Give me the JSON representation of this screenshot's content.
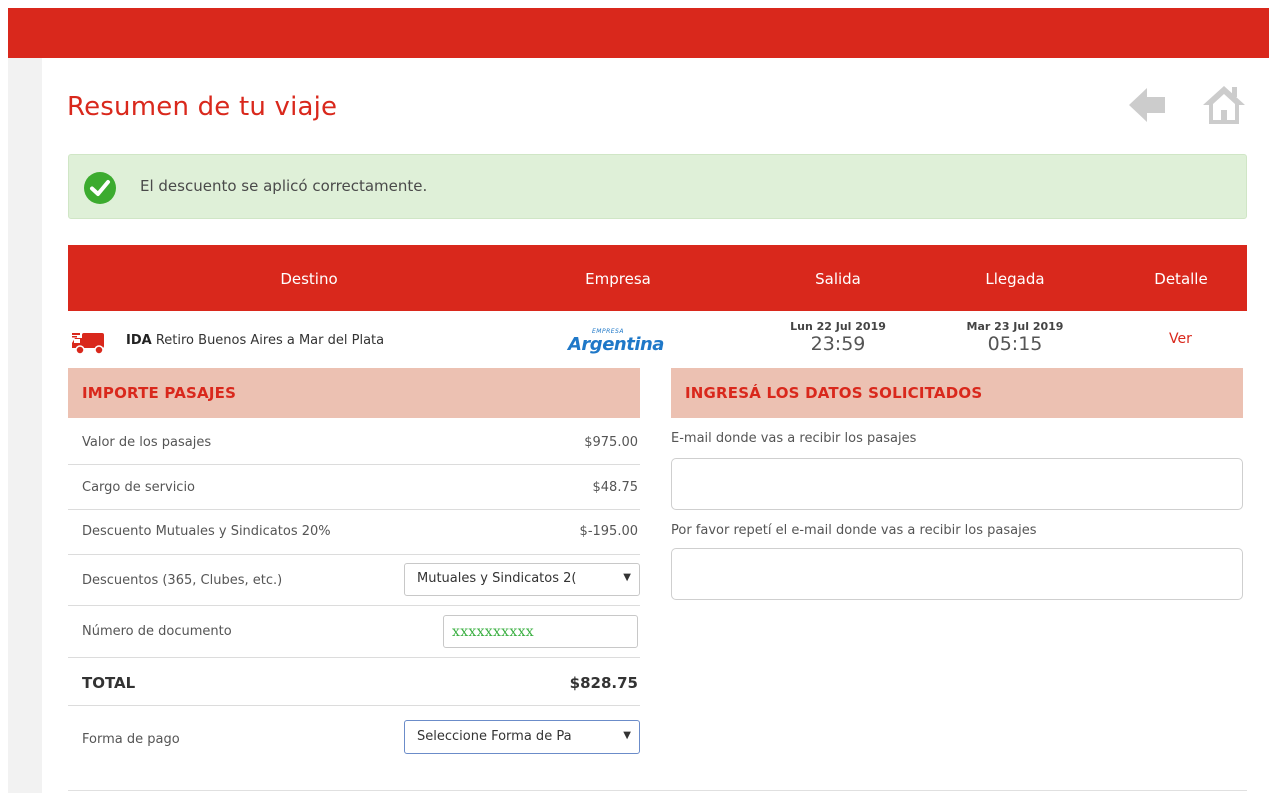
{
  "page": {
    "title": "Resumen de tu viaje"
  },
  "alert": {
    "message": "El descuento se aplicó correctamente."
  },
  "table_headers": {
    "destino": "Destino",
    "empresa": "Empresa",
    "salida": "Salida",
    "llegada": "Llegada",
    "detalle": "Detalle"
  },
  "trip": {
    "direction": "IDA",
    "route": "Retiro Buenos Aires a Mar del Plata",
    "company_logo_small": "EMPRESA",
    "company_logo": "Argentina",
    "departure_date": "Lun 22 Jul 2019",
    "departure_time": "23:59",
    "arrival_date": "Mar 23 Jul 2019",
    "arrival_time": "05:15",
    "detail_link": "Ver"
  },
  "importe": {
    "title": "IMPORTE PASAJES",
    "valor_label": "Valor de los pasajes",
    "valor": "$975.00",
    "cargo_label": "Cargo de servicio",
    "cargo": "$48.75",
    "descuento_label": "Descuento Mutuales y Sindicatos 20%",
    "descuento": "$-195.00",
    "descuentos_select_label": "Descuentos (365, Clubes, etc.)",
    "descuentos_select_value": "Mutuales y Sindicatos 2(",
    "documento_label": "Número de documento",
    "documento_value": "xxxxxxxxxx",
    "total_label": "TOTAL",
    "total": "$828.75",
    "forma_pago_label": "Forma de pago",
    "forma_pago_value": "Seleccione Forma de Pa"
  },
  "datos": {
    "title": "INGRESÁ LOS DATOS SOLICITADOS",
    "email_label": "E-mail donde vas a recibir los pasajes",
    "email_value": "",
    "email_repeat_label": "Por favor repetí el e-mail donde vas a recibir los pasajes",
    "email_repeat_value": ""
  },
  "colors": {
    "brand_red": "#d9281c",
    "section_header_bg": "#ecc1b2",
    "alert_bg": "#dff0d8",
    "success_green": "#3cab2f"
  }
}
